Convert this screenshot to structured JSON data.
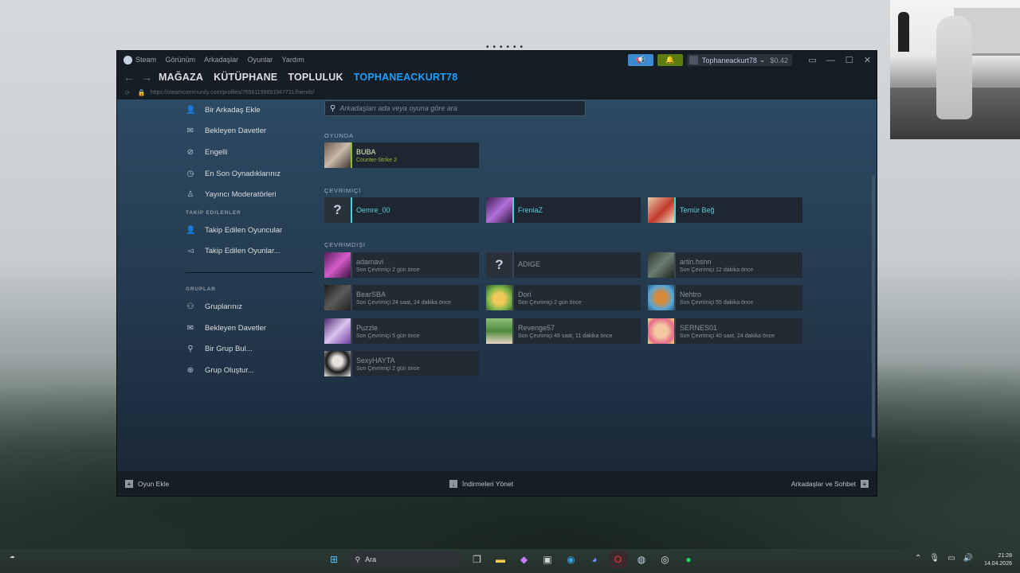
{
  "titlebar": {
    "app": "Steam",
    "menu": [
      "Görünüm",
      "Arkadaşlar",
      "Oyunlar",
      "Yardım"
    ],
    "account_name": "Tophaneackurt78",
    "balance": "$0.42"
  },
  "nav": {
    "tabs": [
      "MAĞAZA",
      "KÜTÜPHANE",
      "TOPLULUK",
      "TOPHANEACKURT78"
    ],
    "url": "https://steamcommunity.com/profiles/76561199891947731/friends/"
  },
  "sidebar": {
    "friend_items": [
      "Bir Arkadaş Ekle",
      "Bekleyen Davetler",
      "Engelli",
      "En Son Oynadıklarınız",
      "Yayıncı Moderatörleri"
    ],
    "following_header": "TAKİP EDİLENLER",
    "following_items": [
      "Takip Edilen Oyuncular",
      "Takip Edilen Oyunlar..."
    ],
    "groups_header": "GRUPLAR",
    "group_items": [
      "Gruplarınız",
      "Bekleyen Davetler",
      "Bir Grup Bul...",
      "Grup Oluştur..."
    ]
  },
  "search": {
    "placeholder": "Arkadaşları ada veya oyuna göre ara"
  },
  "sections": {
    "ingame": "OYUNDA",
    "online": "ÇEVRİMİÇİ",
    "offline": "ÇEVRİMDIŞI"
  },
  "friends": {
    "ingame": [
      {
        "name": "BUBA",
        "status": "Counter-Strike 2"
      }
    ],
    "online": [
      {
        "name": "Oemre_00"
      },
      {
        "name": "FreniaZ"
      },
      {
        "name": "Temür Beğ"
      }
    ],
    "offline": [
      {
        "name": "adamavi",
        "status": "Son Çevrimiçi 2 gün önce"
      },
      {
        "name": "ADIGE",
        "status": ""
      },
      {
        "name": "artin.hsnn",
        "status": "Son Çevrimiçi 12 dakika önce"
      },
      {
        "name": "BearSBA",
        "status": "Son Çevrimiçi 24 saat, 24 dakika önce"
      },
      {
        "name": "Dori",
        "status": "Son Çevrimiçi 2 gün önce"
      },
      {
        "name": "Nehtro",
        "status": "Son Çevrimiçi 55 dakika önce"
      },
      {
        "name": "Puzzle",
        "status": "Son Çevrimiçi 5 gün önce"
      },
      {
        "name": "Revenge57",
        "status": "Son Çevrimiçi 46 saat, 11 dakika önce"
      },
      {
        "name": "SERNES01",
        "status": "Son Çevrimiçi 40 saat, 24 dakika önce"
      },
      {
        "name": "SexyHAYTA",
        "status": "Son Çevrimiçi 2 gün önce"
      }
    ]
  },
  "footer": {
    "add_game": "Oyun Ekle",
    "downloads": "İndirmeleri Yönet",
    "friends_chat": "Arkadaşlar ve Sohbet"
  },
  "taskbar": {
    "search": "Ara",
    "time": "21:28",
    "date": "14.04.2026"
  },
  "colors": {
    "accent": "#1a9fff",
    "ingame": "#90ba3c",
    "online": "#57cbde"
  }
}
